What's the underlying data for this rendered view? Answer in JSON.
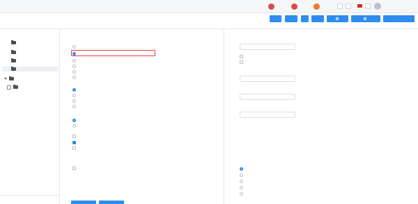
{
  "topbar": {
    "links": [
      {
        "label": "",
        "icon": "red-circle-icon"
      },
      {
        "label": "",
        "icon": "red-circle-icon"
      },
      {
        "label": "",
        "icon": "orange-circle-icon"
      }
    ],
    "user_label": ""
  },
  "header": {
    "title": "",
    "buttons": [
      {
        "label": ""
      },
      {
        "label": ""
      },
      {
        "label": ""
      },
      {
        "label": ""
      },
      {
        "label": ""
      },
      {
        "label": ""
      },
      {
        "label": ""
      }
    ]
  },
  "tree": {
    "items": [
      {
        "label": ""
      },
      {
        "label": ""
      },
      {
        "label": ""
      },
      {
        "label": "",
        "selected": true
      },
      {
        "label": ""
      },
      {
        "label": "",
        "badge": ""
      }
    ]
  },
  "left_footer": {
    "link_1": "",
    "link_2": ""
  },
  "middle": {
    "group_1": {
      "title": "",
      "options": [
        "",
        "",
        "",
        "",
        "",
        ""
      ]
    },
    "group_2": {
      "title": "",
      "options": [
        "",
        "",
        "",
        ""
      ]
    },
    "group_3": {
      "title": "",
      "options": [
        "",
        ""
      ],
      "checks": [
        "",
        "",
        ""
      ]
    },
    "group_4": {
      "title": "",
      "options": [
        ""
      ]
    }
  },
  "right": {
    "field_1": {
      "label": "",
      "value": ""
    },
    "checks": [
      "",
      ""
    ],
    "field_2": {
      "label": "",
      "value": ""
    },
    "field_3": {
      "label": "",
      "value": ""
    },
    "field_4": {
      "label": "",
      "value": ""
    },
    "radio_group": {
      "title": "",
      "options": [
        "",
        "",
        "",
        "",
        ""
      ]
    }
  },
  "colors": {
    "accent": "#2d8cf0",
    "highlight": "#e0393c",
    "link_red": "#c0392b"
  }
}
